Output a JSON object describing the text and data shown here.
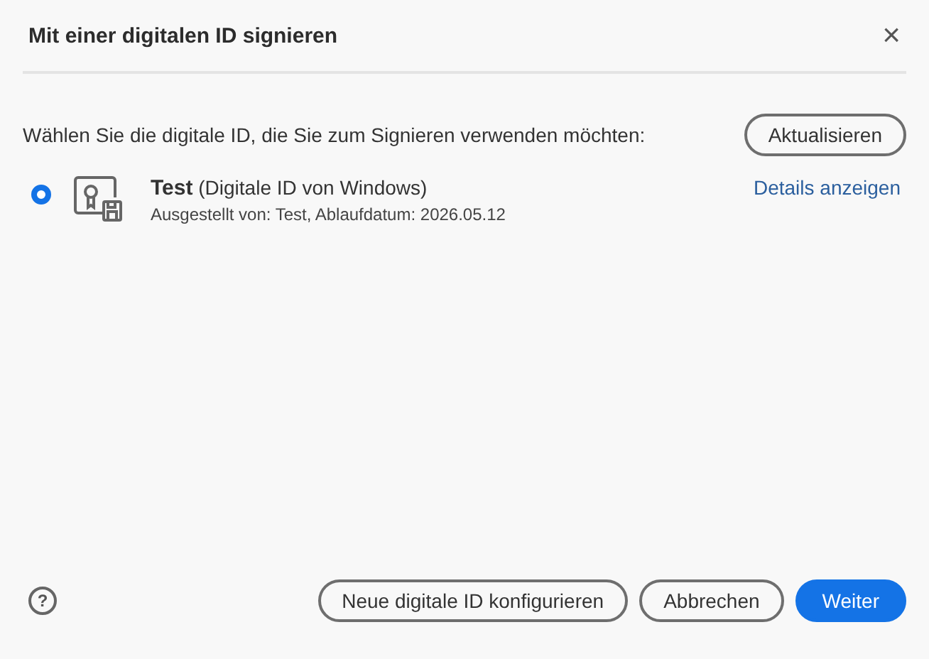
{
  "window": {
    "title": "Mit einer digitalen ID signieren",
    "close": "×"
  },
  "instruction": "Wählen Sie die digitale ID, die Sie zum Signieren verwenden möchten:",
  "refresh_button": "Aktualisieren",
  "ids": [
    {
      "name": "**Test** (Digitale ID von Windows)",
      "issued": "Ausgestellt von: Test, Ablaufdatum: 2026.05.12",
      "details_link": "Details anzeigen",
      "selected": true
    }
  ],
  "help": "?",
  "buttons": [
    {
      "label": "Neue digitale ID konfigurieren",
      "kind": "secondary"
    },
    {
      "label": "Abbrechen",
      "kind": "secondary"
    },
    {
      "label": "Weiter",
      "kind": "primary"
    }
  ]
}
